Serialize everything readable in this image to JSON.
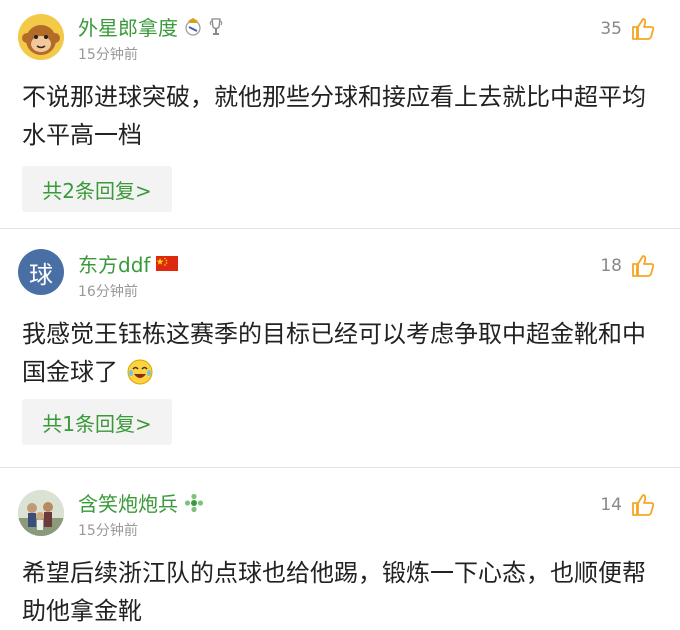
{
  "comments": [
    {
      "username": "外星郎拿度",
      "time": "15分钟前",
      "likes": "35",
      "text": "不说那进球突破，就他那些分球和接应看上去就比中超平均水平高一档",
      "reply_label": "共2条回复>"
    },
    {
      "avatar_text": "球",
      "username": "东方ddf",
      "time": "16分钟前",
      "likes": "18",
      "text": "我感觉王钰栋这赛季的目标已经可以考虑争取中超金靴和中国金球了",
      "reply_label": "共1条回复>"
    },
    {
      "username": "含笑炮炮兵",
      "time": "15分钟前",
      "likes": "14",
      "text": "希望后续浙江队的点球也给他踢，锻炼一下心态，也顺便帮助他拿金靴"
    }
  ],
  "colors": {
    "username": "#3a9a3a",
    "like_icon": "#f5a623",
    "reply_bg": "#f3f3f3"
  },
  "icons": [
    "thumbs-up-icon",
    "real-madrid-badge-icon",
    "trophy-badge-icon",
    "china-flag-icon",
    "laughing-emoji-icon",
    "green-badge-icon",
    "monkey-avatar",
    "group-photo-avatar"
  ]
}
